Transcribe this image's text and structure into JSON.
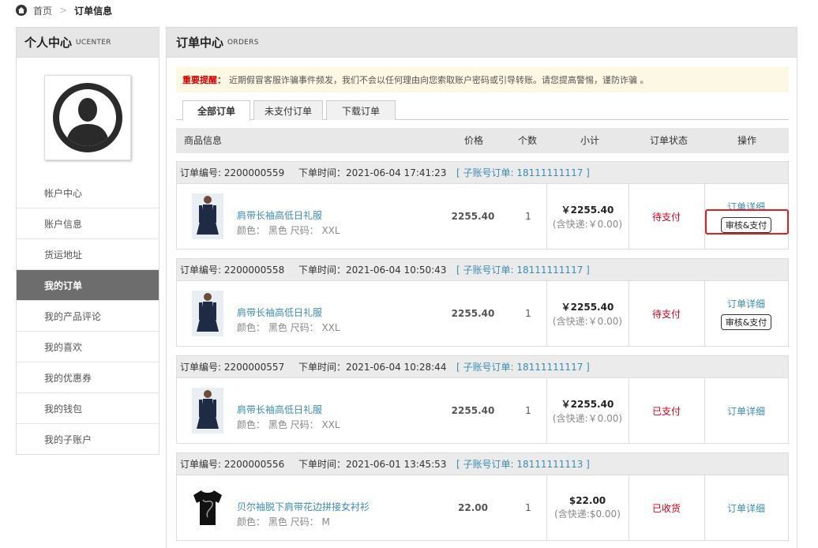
{
  "breadcrumb": {
    "home": "首页",
    "sep": ">",
    "current": "订单信息"
  },
  "sidebar": {
    "title": "个人中心",
    "subtitle": "UCENTER",
    "items": [
      {
        "label": "帐户中心",
        "active": false
      },
      {
        "label": "账户信息",
        "active": false
      },
      {
        "label": "货运地址",
        "active": false
      },
      {
        "label": "我的订单",
        "active": true
      },
      {
        "label": "我的产品评论",
        "active": false
      },
      {
        "label": "我的喜欢",
        "active": false
      },
      {
        "label": "我的优惠券",
        "active": false
      },
      {
        "label": "我的钱包",
        "active": false
      },
      {
        "label": "我的子账户",
        "active": false
      }
    ]
  },
  "main": {
    "title": "订单中心",
    "subtitle": "ORDERS",
    "notice_label": "重要提醒：",
    "notice_text": "近期假冒客服诈骗事件频发，我们不会以任何理由向您索取账户密码或引导转账。请您提高警惕，谨防诈骗 。",
    "tabs": [
      {
        "label": "全部订单",
        "active": true
      },
      {
        "label": "未支付订单",
        "active": false
      },
      {
        "label": "下载订单",
        "active": false
      }
    ],
    "columns": {
      "product": "商品信息",
      "price": "价格",
      "qty": "个数",
      "subtotal": "小计",
      "status": "订单状态",
      "ops": "操作"
    }
  },
  "orders": [
    {
      "no": "订单编号: 2200000559",
      "time": "下单时间：2021-06-04 17:41:23",
      "sub": "[ 子账号订单: 18111111117 ]",
      "product": "肩带长袖高低日礼服",
      "attrs": "颜色： 黑色   尺码： XXL",
      "price": "2255.40",
      "qty": "1",
      "amount": "￥2255.40",
      "shipping": "(含快递:￥0.00)",
      "status": "待支付",
      "detail": "订单详细",
      "action": "审核&支付"
    },
    {
      "no": "订单编号: 2200000558",
      "time": "下单时间：2021-06-04 10:50:43",
      "sub": "[ 子账号订单: 18111111117 ]",
      "product": "肩带长袖高低日礼服",
      "attrs": "颜色： 黑色   尺码： XXL",
      "price": "2255.40",
      "qty": "1",
      "amount": "￥2255.40",
      "shipping": "(含快递:￥0.00)",
      "status": "待支付",
      "detail": "订单详细",
      "action": "审核&支付"
    },
    {
      "no": "订单编号: 2200000557",
      "time": "下单时间：2021-06-04 10:28:44",
      "sub": "[ 子账号订单: 18111111117 ]",
      "product": "肩带长袖高低日礼服",
      "attrs": "颜色： 黑色   尺码： XXL",
      "price": "2255.40",
      "qty": "1",
      "amount": "￥2255.40",
      "shipping": "(含快递:￥0.00)",
      "status": "已支付",
      "detail": "订单详细",
      "action": ""
    },
    {
      "no": "订单编号: 2200000556",
      "time": "下单时间：2021-06-01 13:45:53",
      "sub": "[ 子账号订单: 18111111113 ]",
      "product": "贝尔袖脱下肩带花边拼接女衬衫",
      "attrs": "颜色： 黑色   尺码： M",
      "price": "22.00",
      "qty": "1",
      "amount": "$22.00",
      "shipping": "(含快递:$0.00)",
      "status": "已收货",
      "detail": "订单详细",
      "action": ""
    }
  ],
  "colors": {
    "link": "#3b8db4",
    "status_pending": "#d0021b",
    "highlight": "#e02020",
    "active_menu": "#6d6d6d",
    "notice_bg": "#fdf8e4"
  }
}
